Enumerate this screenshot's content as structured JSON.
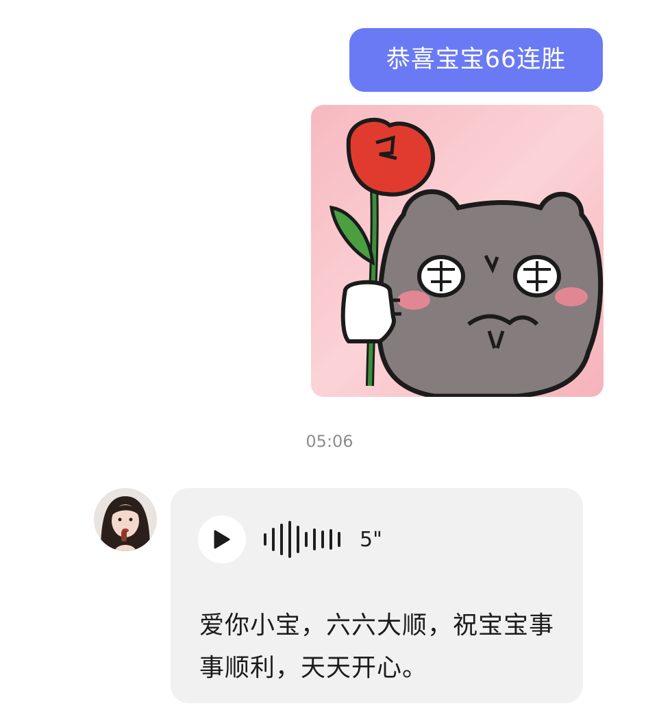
{
  "sent_message": {
    "text": "恭喜宝宝66连胜",
    "bubble_color": "#6a7af4"
  },
  "sticker": {
    "icon": "bear-with-rose-sticker"
  },
  "timestamp": "05:06",
  "received_message": {
    "avatar": "user-avatar",
    "voice_duration": "5\"",
    "transcript": "爱你小宝，六六大顺，祝宝宝事事顺利，天天开心。",
    "bubble_color": "#f1f1f1"
  }
}
